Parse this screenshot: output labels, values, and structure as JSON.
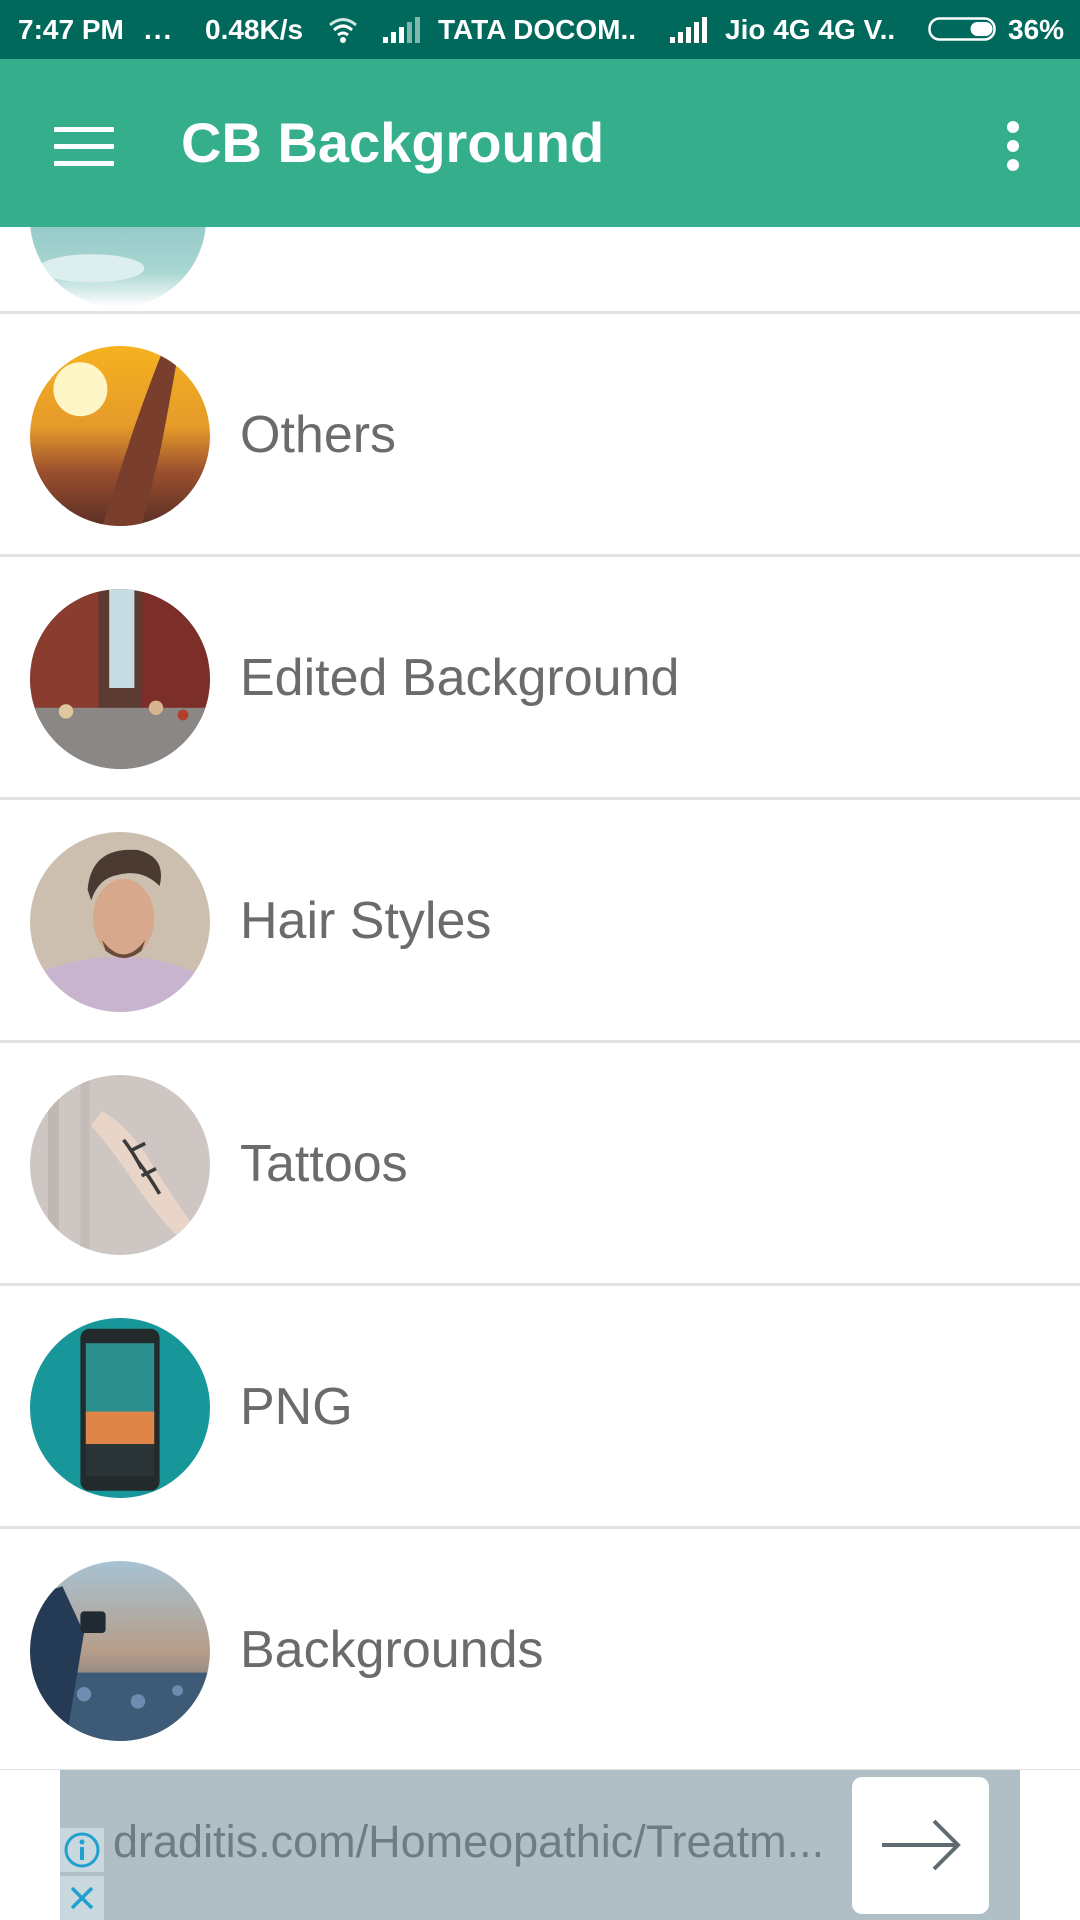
{
  "status_bar": {
    "time": "7:47 PM",
    "dots": "...",
    "speed": "0.48K/s",
    "carrier1": "TATA DOCOM..",
    "carrier2": "Jio 4G 4G  V..",
    "battery": "36%",
    "battery_level": 0.36
  },
  "app_bar": {
    "title": "CB Background",
    "menu_icon": "hamburger-menu-icon",
    "overflow_icon": "more-vert-icon",
    "color": "#35ae8b"
  },
  "categories": [
    {
      "label": "Others",
      "thumb": "sunset-hand"
    },
    {
      "label": "Edited Background",
      "thumb": "city-street"
    },
    {
      "label": "Hair Styles",
      "thumb": "man-portrait"
    },
    {
      "label": "Tattoos",
      "thumb": "arm-tattoo"
    },
    {
      "label": "PNG",
      "thumb": "phone-desert"
    },
    {
      "label": "Backgrounds",
      "thumb": "camera-landscape"
    }
  ],
  "ad": {
    "text": "draditis.com/Homeopathic/Treatm...",
    "info_icon": "info-icon",
    "close_icon": "close-icon",
    "arrow_icon": "arrow-right-icon"
  }
}
